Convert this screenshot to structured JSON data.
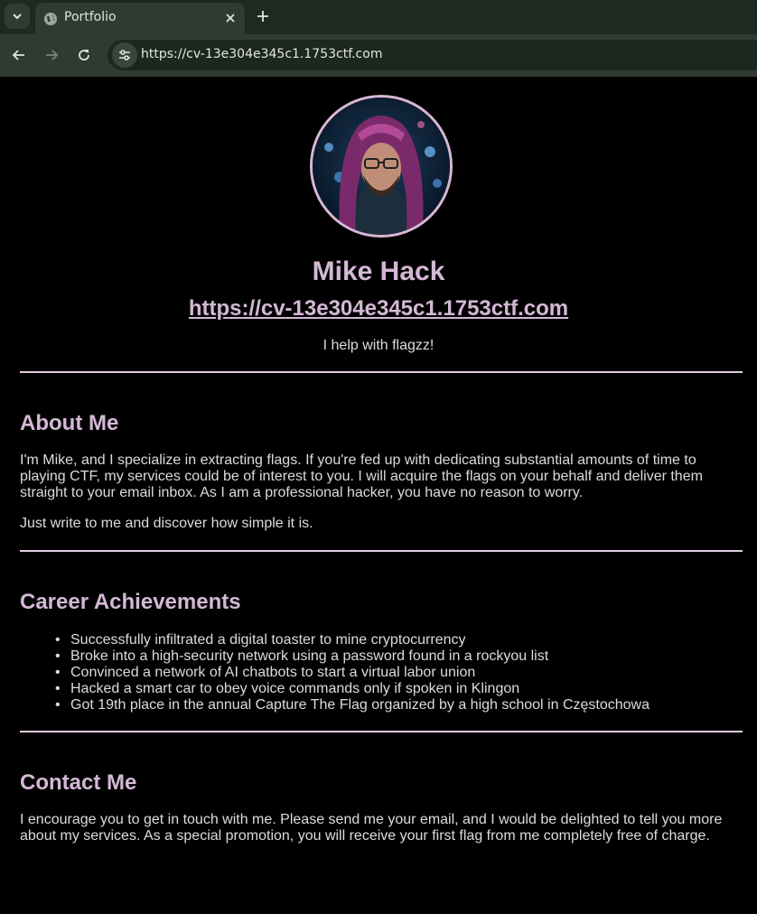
{
  "browser": {
    "tab_title": "Portfolio",
    "url": "https://cv-13e304e345c1.1753ctf.com"
  },
  "profile": {
    "name": "Mike Hack",
    "site": "https://cv-13e304e345c1.1753ctf.com",
    "tagline": "I help with flagzz!"
  },
  "about": {
    "heading": "About Me",
    "p1": "I'm Mike, and I specialize in extracting flags. If you're fed up with dedicating substantial amounts of time to playing CTF, my services could be of interest to you. I will acquire the flags on your behalf and deliver them straight to your email inbox. As I am a professional hacker, you have no reason to worry.",
    "p2": "Just write to me and discover how simple it is."
  },
  "career": {
    "heading": "Career Achievements",
    "items": [
      "Successfully infiltrated a digital toaster to mine cryptocurrency",
      "Broke into a high-security network using a password found in a rockyou list",
      "Convinced a network of AI chatbots to start a virtual labor union",
      "Hacked a smart car to obey voice commands only if spoken in Klingon",
      "Got 19th place in the annual Capture The Flag organized by a high school in Częstochowa"
    ]
  },
  "contact": {
    "heading": "Contact Me",
    "text": "I encourage you to get in touch with me. Please send me your email, and I would be delighted to tell you more about my services. As a special promotion, you will receive your first flag from me completely free of charge."
  }
}
